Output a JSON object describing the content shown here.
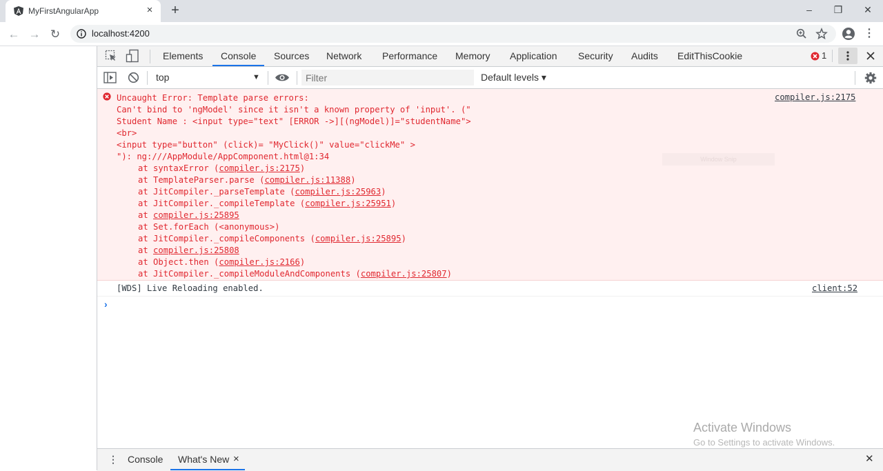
{
  "browser": {
    "tab_title": "MyFirstAngularApp",
    "tab_close": "×",
    "new_tab": "+",
    "window_controls": {
      "minimize": "–",
      "restore": "❐",
      "close": "✕"
    },
    "nav": {
      "back": "←",
      "forward": "→",
      "reload": "↻"
    },
    "url": "localhost:4200",
    "icons": [
      "info-icon",
      "zoom-icon",
      "star-icon",
      "profile-icon",
      "menu-icon"
    ],
    "menu_glyph": "⋮"
  },
  "devtools": {
    "tabs": [
      "Elements",
      "Console",
      "Sources",
      "Network",
      "Performance",
      "Memory",
      "Application",
      "Security",
      "Audits",
      "EditThisCookie"
    ],
    "active_tab": "Console",
    "error_count": "1",
    "toolbar": {
      "context": "top",
      "filter_placeholder": "Filter",
      "levels": "Default levels ▾"
    },
    "accent": "#1a73e8",
    "error_color": "#e0272f"
  },
  "console": {
    "error": {
      "source": "compiler.js:2175",
      "lines": [
        "Uncaught Error: Template parse errors:",
        "Can't bind to 'ngModel' since it isn't a known property of 'input'. (\"",
        "Student Name : <input type=\"text\" [ERROR ->][(ngModel)]=\"studentName\">",
        "<br>",
        "<input type=\"button\" (click)= \"MyClick()\" value=\"clickMe\" >",
        "\"): ng:///AppModule/AppComponent.html@1:34"
      ],
      "stack": [
        {
          "pre": "at syntaxError (",
          "link": "compiler.js:2175",
          "post": ")"
        },
        {
          "pre": "at TemplateParser.parse (",
          "link": "compiler.js:11388",
          "post": ")"
        },
        {
          "pre": "at JitCompiler._parseTemplate (",
          "link": "compiler.js:25963",
          "post": ")"
        },
        {
          "pre": "at JitCompiler._compileTemplate (",
          "link": "compiler.js:25951",
          "post": ")"
        },
        {
          "pre": "at ",
          "link": "compiler.js:25895",
          "post": ""
        },
        {
          "pre": "at Set.forEach (<anonymous>)",
          "link": "",
          "post": ""
        },
        {
          "pre": "at JitCompiler._compileComponents (",
          "link": "compiler.js:25895",
          "post": ")"
        },
        {
          "pre": "at ",
          "link": "compiler.js:25808",
          "post": ""
        },
        {
          "pre": "at Object.then (",
          "link": "compiler.js:2166",
          "post": ")"
        },
        {
          "pre": "at JitCompiler._compileModuleAndComponents (",
          "link": "compiler.js:25807",
          "post": ")"
        }
      ]
    },
    "log": {
      "text": "[WDS] Live Reloading enabled.",
      "source": "client:52"
    },
    "prompt": "›"
  },
  "drawer": {
    "tabs": [
      "Console",
      "What's New"
    ],
    "active_tab": "What's New",
    "tab_close": "×",
    "close": "✕",
    "menu": "⋮"
  },
  "watermark": {
    "title": "Activate Windows",
    "subtitle": "Go to Settings to activate Windows.",
    "faint": "Window Snip"
  }
}
